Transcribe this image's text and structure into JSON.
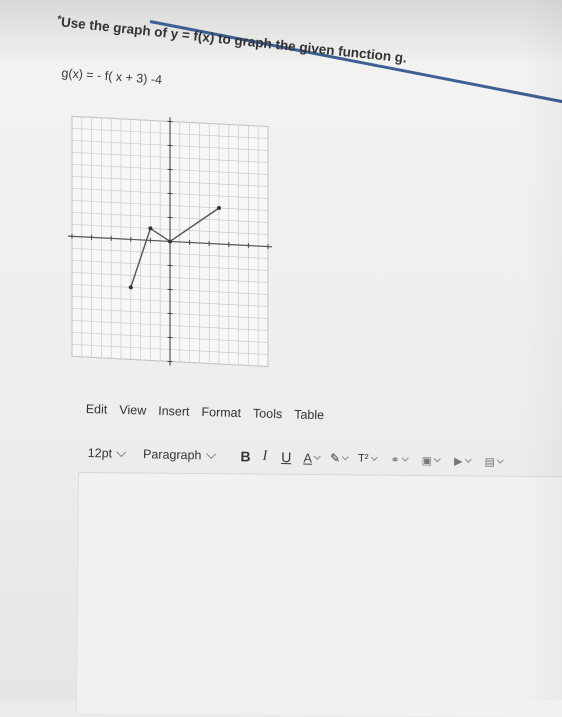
{
  "question": {
    "marker": "*",
    "text": "Use the graph of y = f(x) to graph the given function g."
  },
  "function_text": "g(x) = - f( x + 3) -4",
  "graph": {
    "x_range": [
      -10,
      10
    ],
    "y_range": [
      -10,
      10
    ],
    "f_points": [
      [
        -4,
        -4
      ],
      [
        -2,
        1
      ],
      [
        0,
        0
      ],
      [
        5,
        3
      ]
    ]
  },
  "menubar": {
    "items": [
      "Edit",
      "View",
      "Insert",
      "Format",
      "Tools",
      "Table"
    ]
  },
  "toolbar": {
    "font_size": "12pt",
    "block_format": "Paragraph",
    "bold": "B",
    "italic": "I",
    "underline": "U",
    "text_color": "A",
    "highlight_icon": "highlighter-icon",
    "superscript": "T²",
    "link_icon": "link-icon",
    "image_icon": "image-icon",
    "media_icon": "media-icon",
    "document_icon": "document-icon"
  },
  "colors": {
    "accent_line": "#3d5f93",
    "grid": "#c9c9c9",
    "plot": "#555555"
  }
}
